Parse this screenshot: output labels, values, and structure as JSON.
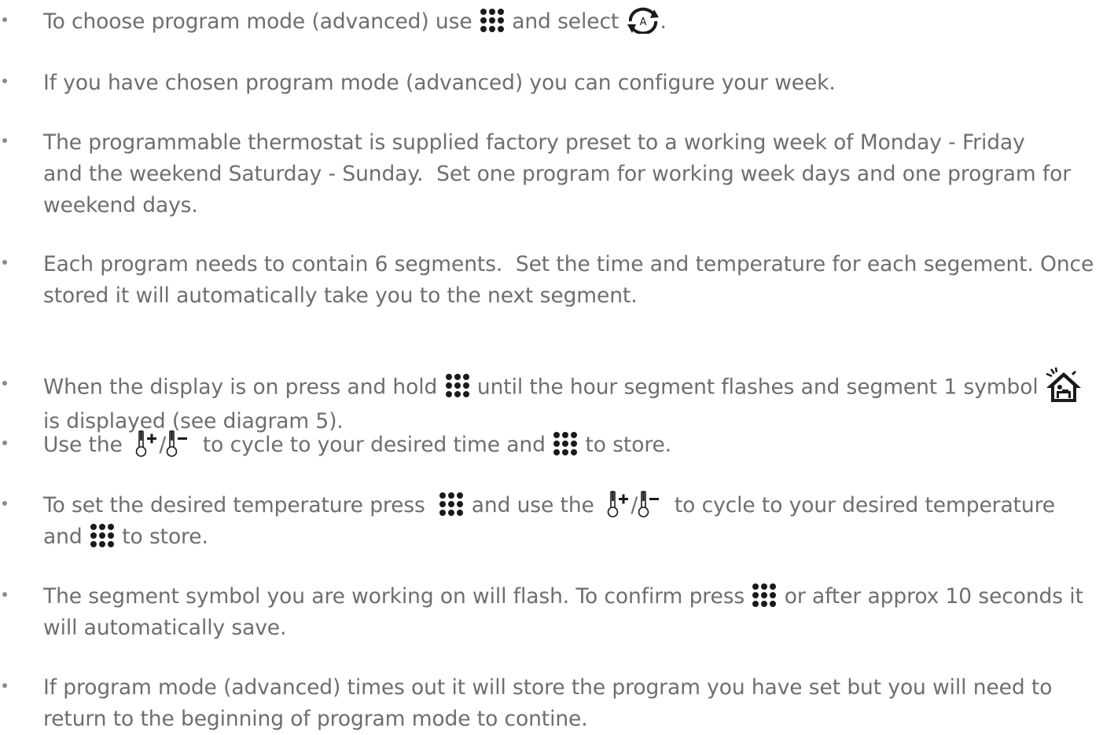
{
  "instructions": [
    {
      "parts": [
        {
          "t": "To choose program mode (advanced) use "
        },
        {
          "icon": "menu-dots-icon"
        },
        {
          "t": " and select "
        },
        {
          "icon": "auto-mode-icon"
        },
        {
          "t": "."
        }
      ]
    },
    {
      "parts": [
        {
          "t": "If you have chosen program mode (advanced) you can configure your week."
        }
      ]
    },
    {
      "parts": [
        {
          "t": "The programmable thermostat is supplied factory preset to a working week of Monday - Friday"
        },
        {
          "br": true
        },
        {
          "t": "and the weekend Saturday - Sunday.  Set one program for working week days and one program for"
        },
        {
          "br": true
        },
        {
          "t": "weekend days."
        }
      ]
    },
    {
      "parts": [
        {
          "t": "Each program needs to contain 6 segments.  Set the time and temperature for each segement. Once"
        },
        {
          "br": true
        },
        {
          "t": "stored it will automatically take you to the next segment."
        }
      ]
    },
    {
      "parts": [
        {
          "t": "When the display is on press and hold "
        },
        {
          "icon": "menu-dots-icon"
        },
        {
          "t": " until the hour segment flashes and segment 1 symbol "
        },
        {
          "icon": "home-wake-icon"
        },
        {
          "br": true
        },
        {
          "t": "is displayed (see diagram 5)."
        }
      ]
    },
    {
      "parts": [
        {
          "t": "Use the  "
        },
        {
          "icon": "temp-up-icon"
        },
        {
          "t": "/"
        },
        {
          "icon": "temp-down-icon"
        },
        {
          "t": "  to cycle to your desired time and "
        },
        {
          "icon": "menu-dots-icon"
        },
        {
          "t": " to store."
        }
      ]
    },
    {
      "parts": [
        {
          "t": "To set the desired temperature press  "
        },
        {
          "icon": "menu-dots-icon"
        },
        {
          "t": " and use the  "
        },
        {
          "icon": "temp-up-icon"
        },
        {
          "t": "/"
        },
        {
          "icon": "temp-down-icon"
        },
        {
          "t": "  to cycle to your desired temperature"
        },
        {
          "br": true
        },
        {
          "t": "and "
        },
        {
          "icon": "menu-dots-icon"
        },
        {
          "t": " to store."
        }
      ]
    },
    {
      "parts": [
        {
          "t": "The segment symbol you are working on will flash. To confirm press "
        },
        {
          "icon": "menu-dots-icon"
        },
        {
          "t": " or after approx 10 seconds it"
        },
        {
          "br": true
        },
        {
          "t": "will automatically save."
        }
      ]
    },
    {
      "parts": [
        {
          "t": "If program mode (advanced) times out it will store the program you have set but you will need to"
        },
        {
          "br": true
        },
        {
          "t": "return to the beginning of program mode to contine."
        }
      ]
    }
  ],
  "colors": {
    "text": "#6d6e71",
    "bullet": "#8a8b8e",
    "icon": "#1a1a1a"
  }
}
